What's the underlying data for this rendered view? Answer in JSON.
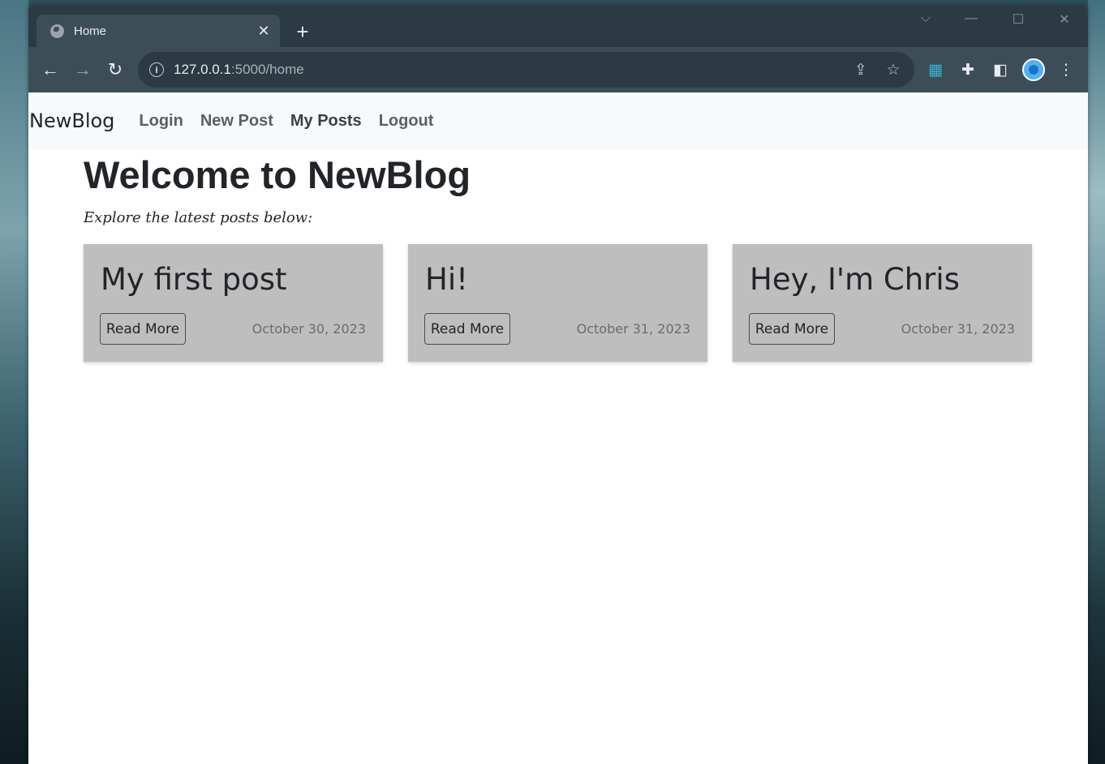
{
  "browser": {
    "tab_title": "Home",
    "tab_close": "✕",
    "new_tab": "+",
    "url_host": "127.0.0.1",
    "url_rest": ":5000/home",
    "controls": {
      "tab_search": "⌵",
      "minimize": "—",
      "maximize": "☐",
      "close": "✕"
    },
    "nav": {
      "back": "←",
      "forward": "→",
      "reload": "↻"
    }
  },
  "site": {
    "brand": "NewBlog",
    "nav": [
      {
        "label": "Login"
      },
      {
        "label": "New Post"
      },
      {
        "label": "My Posts"
      },
      {
        "label": "Logout"
      }
    ]
  },
  "main": {
    "title": "Welcome to NewBlog",
    "subtitle": "Explore the latest posts below:",
    "posts": [
      {
        "title": "My first post",
        "button": "Read More",
        "date": "October 30, 2023"
      },
      {
        "title": "Hi!",
        "button": "Read More",
        "date": "October 31, 2023"
      },
      {
        "title": "Hey, I'm Chris",
        "button": "Read More",
        "date": "October 31, 2023"
      }
    ]
  },
  "icons": {
    "favicon": "globe-icon",
    "info": "info-icon",
    "share": "share-icon",
    "bookmark": "star-icon",
    "extension1": "scanner-extension-icon",
    "extensions": "puzzle-icon",
    "sidepanel": "side-panel-icon",
    "profile": "profile-avatar",
    "menu": "kebab-menu-icon"
  },
  "colors": {
    "titlebar": "#2c3a44",
    "toolbar": "#3d4d58",
    "navbar": "#f8f9fa",
    "card": "#bebebe"
  }
}
